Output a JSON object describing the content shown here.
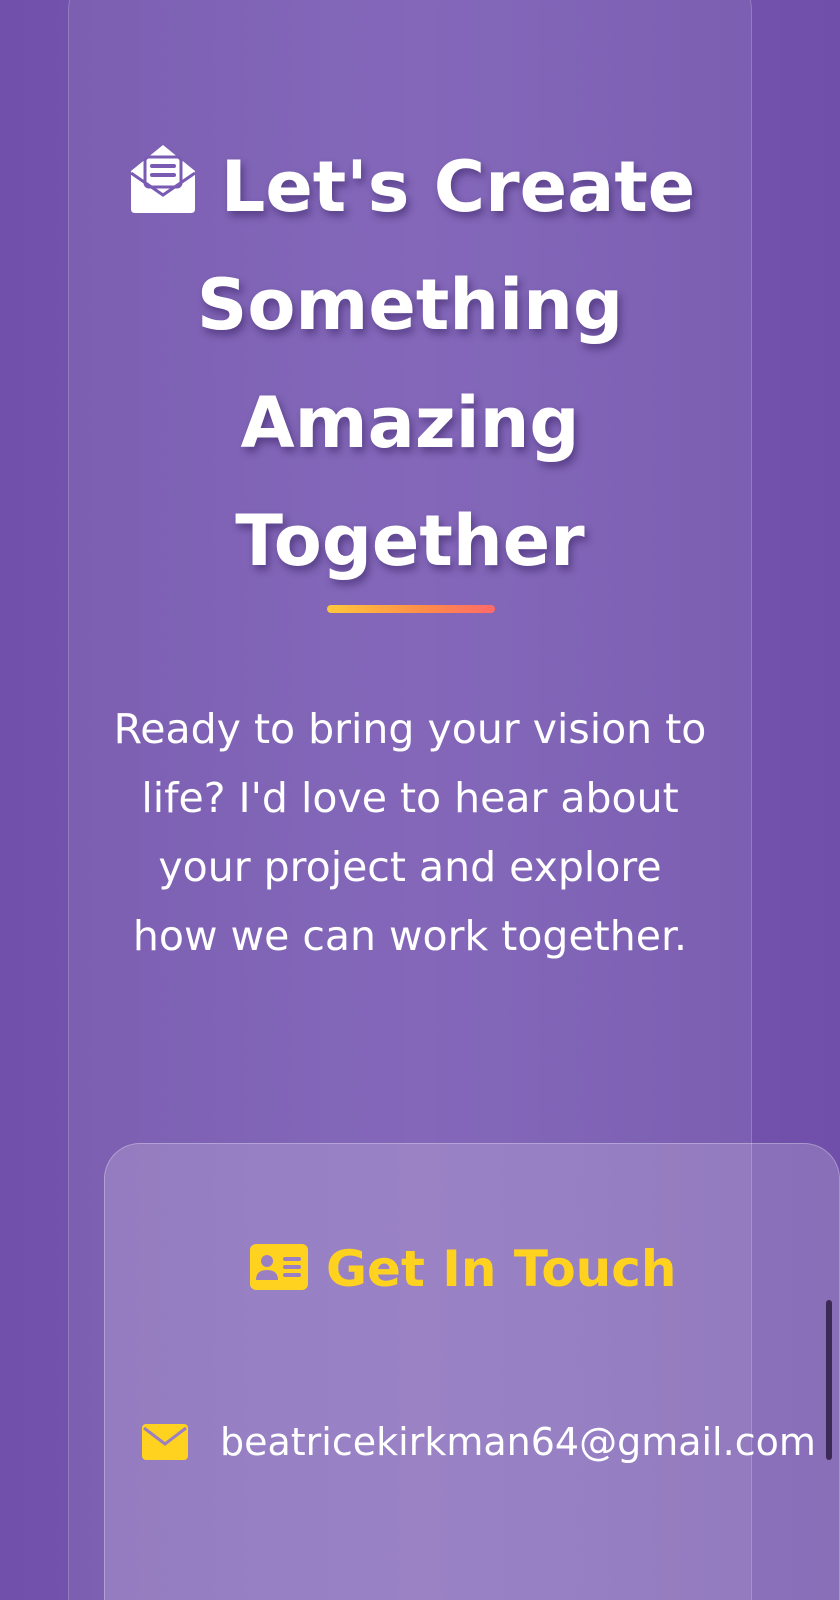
{
  "hero": {
    "icon": "envelope-open-text-icon",
    "title": "Let's Create Something Amazing Together",
    "description": "Ready to bring your vision to life? I'd love to hear about your project and explore how we can work together."
  },
  "contact": {
    "heading_icon": "address-card-icon",
    "heading": "Get In Touch",
    "email_icon": "envelope-icon",
    "email": "beatricekirkman64@gmail.com"
  },
  "colors": {
    "background": "#7556ad",
    "accent_yellow": "#ffd21f",
    "underline_start": "#ffc83a",
    "underline_end": "#ff6a6a",
    "text": "#ffffff"
  }
}
